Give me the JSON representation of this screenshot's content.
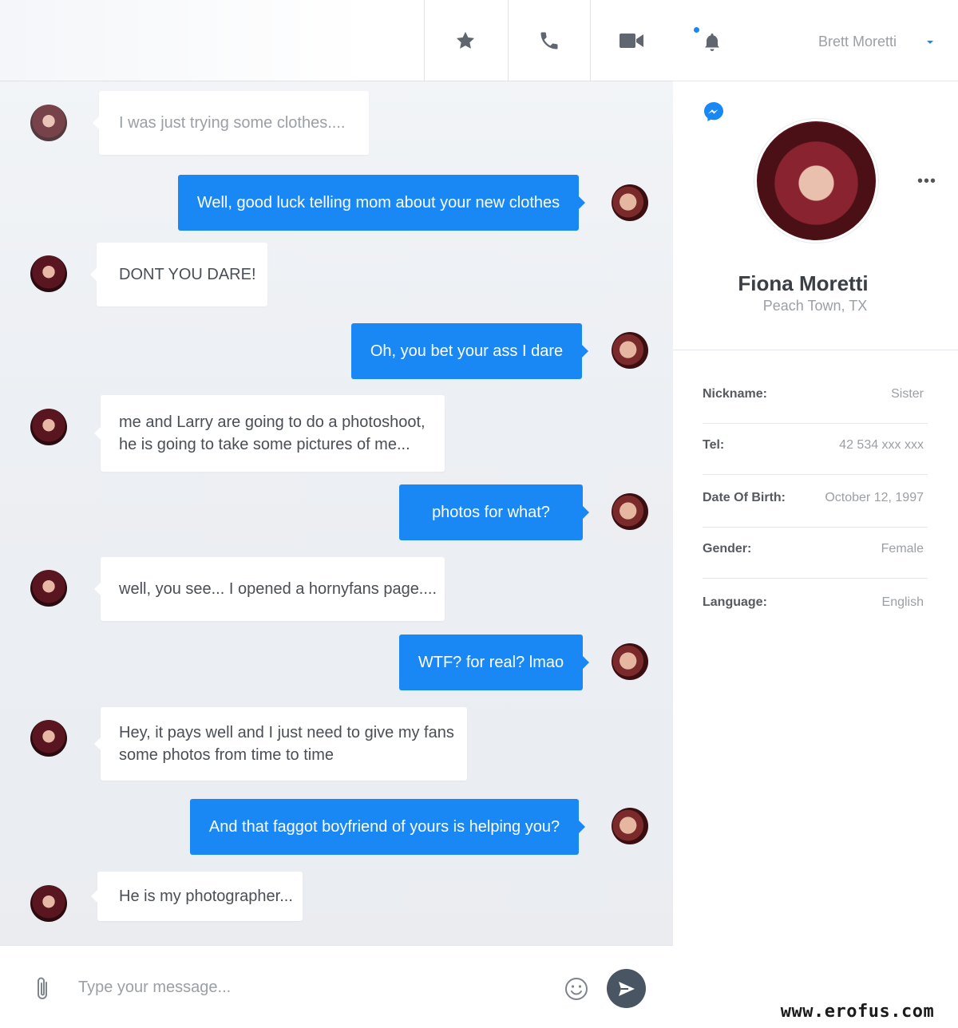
{
  "header": {
    "actions": [
      {
        "name": "favorite",
        "icon": "star-icon"
      },
      {
        "name": "call",
        "icon": "phone-icon"
      },
      {
        "name": "video",
        "icon": "video-camera-icon"
      }
    ]
  },
  "messages": [
    {
      "from": "fiona",
      "text": "I was just trying some clothes...."
    },
    {
      "from": "brett",
      "text": "Well, good luck telling mom about your new clothes"
    },
    {
      "from": "fiona",
      "text": "DONT YOU DARE!"
    },
    {
      "from": "brett",
      "text": "Oh, you bet your ass I dare"
    },
    {
      "from": "fiona",
      "text": "me and Larry are going to do a photoshoot,\nhe is going to take some pictures of me..."
    },
    {
      "from": "brett",
      "text": "photos for what?"
    },
    {
      "from": "fiona",
      "text": "well, you see... I opened a hornyfans page...."
    },
    {
      "from": "brett",
      "text": "WTF? for real? lmao"
    },
    {
      "from": "fiona",
      "text": "Hey, it pays well and I just need to give my fans\nsome photos from time to time"
    },
    {
      "from": "brett",
      "text": "And that faggot boyfriend of yours is helping you?"
    },
    {
      "from": "fiona",
      "text": "He is my photographer..."
    }
  ],
  "composer": {
    "placeholder": "Type your message...",
    "attach_icon": "paperclip-icon",
    "emoji_icon": "smiley-icon",
    "send_icon": "send-icon"
  },
  "account": {
    "username": "Brett Moretti",
    "notification_icon": "bell-icon",
    "has_notification": true
  },
  "profile": {
    "name": "Fiona Moretti",
    "location": "Peach Town, TX",
    "app_icon": "messenger-icon",
    "more_label": "•••",
    "details": [
      {
        "label": "Nickname:",
        "value": "Sister"
      },
      {
        "label": "Tel:",
        "value": "42 534 xxx xxx"
      },
      {
        "label": "Date Of Birth:",
        "value": "October 12, 1997"
      },
      {
        "label": "Gender:",
        "value": "Female"
      },
      {
        "label": "Language:",
        "value": "English"
      }
    ]
  },
  "watermark": "www.erofus.com",
  "colors": {
    "accent": "#1a88f4",
    "send_button": "#4a5563",
    "incoming_text": "#4a4f55",
    "muted_text": "#9aa0a6"
  }
}
